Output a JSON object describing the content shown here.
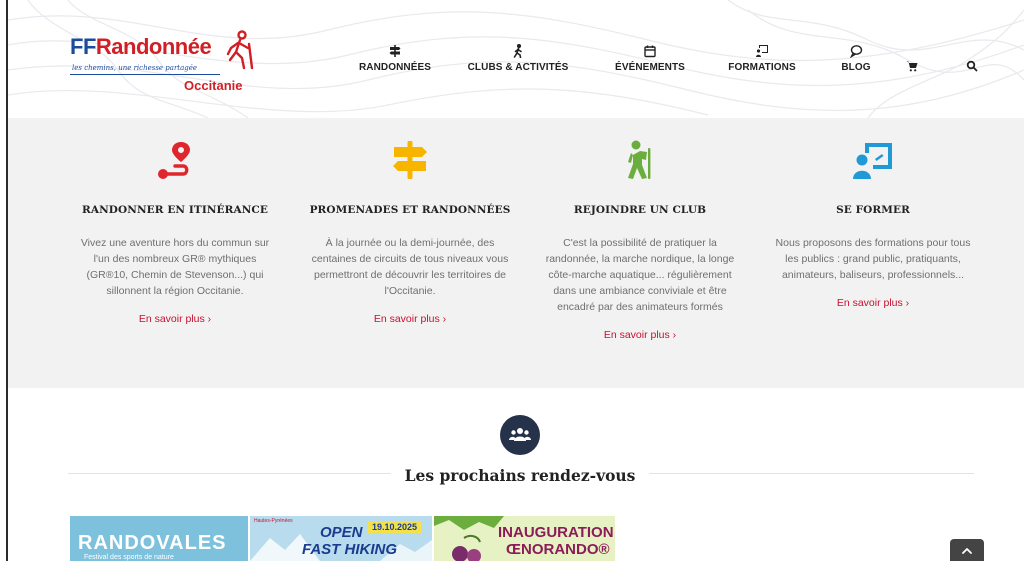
{
  "logo": {
    "ff": "FF",
    "rand": "Randonnée",
    "tagline": "les chemins, une richesse partagée",
    "region": "Occitanie"
  },
  "nav": {
    "items": [
      {
        "label": "RANDONNÉES",
        "icon": "signpost-icon"
      },
      {
        "label": "CLUBS & ACTIVITÉS",
        "icon": "walker-icon"
      },
      {
        "label": "ÉVÉNEMENTS",
        "icon": "calendar-icon"
      },
      {
        "label": "FORMATIONS",
        "icon": "teacher-board-icon"
      },
      {
        "label": "BLOG",
        "icon": "chat-bubble-icon"
      }
    ],
    "cart_icon": "cart-icon",
    "search_icon": "search-icon"
  },
  "features": [
    {
      "title": "RANDONNER EN ITINÉRANCE",
      "desc": [
        "Vivez une aventure hors du commun sur",
        "l'un des nombreux GR® mythiques",
        "(GR®10, Chemin de Stevenson...) qui",
        "sillonnent la région Occitanie."
      ],
      "link": "En savoir plus ›",
      "icon": "route-pin-icon",
      "color": "#e0262d"
    },
    {
      "title": "PROMENADES ET RANDONNÉES",
      "desc": [
        "À la journée ou la demi-journée, des",
        "centaines de circuits de tous niveaux vous",
        "permettront de découvrir les territoires de",
        "l'Occitanie."
      ],
      "link": "En savoir plus ›",
      "icon": "signpost-icon",
      "color": "#f7b500"
    },
    {
      "title": "REJOINDRE UN CLUB",
      "desc": [
        "C'est la possibilité de pratiquer la",
        "randonnée, la marche nordique, la longe",
        "côte-marche aquatique... régulièrement",
        "dans une ambiance conviviale et être",
        "encadré par des animateurs formés"
      ],
      "link": "En savoir plus ›",
      "icon": "hiker-icon",
      "color": "#6cae3e"
    },
    {
      "title": "SE FORMER",
      "desc": [
        "Nous proposons des formations pour tous",
        "les publics : grand public, pratiquants,",
        "animateurs, baliseurs, professionnels..."
      ],
      "link": "En savoir plus ›",
      "icon": "teacher-board-icon",
      "color": "#1f9ad6"
    }
  ],
  "events": {
    "title": "Les prochains rendez-vous",
    "icon": "group-icon",
    "cards": {
      "card1_title": "RANDOVALES",
      "card1_sub": "Festival des sports de nature",
      "card2_tag": "Hautes-Pyrénées",
      "card2_line1": "OPEN",
      "card2_line2": "FAST HIKING",
      "card2_date": "19.10.2025",
      "card3_line1": "INAUGURATION",
      "card3_line2": "ŒNORANDO®"
    }
  },
  "scroll_top_icon": "chevron-up-icon"
}
